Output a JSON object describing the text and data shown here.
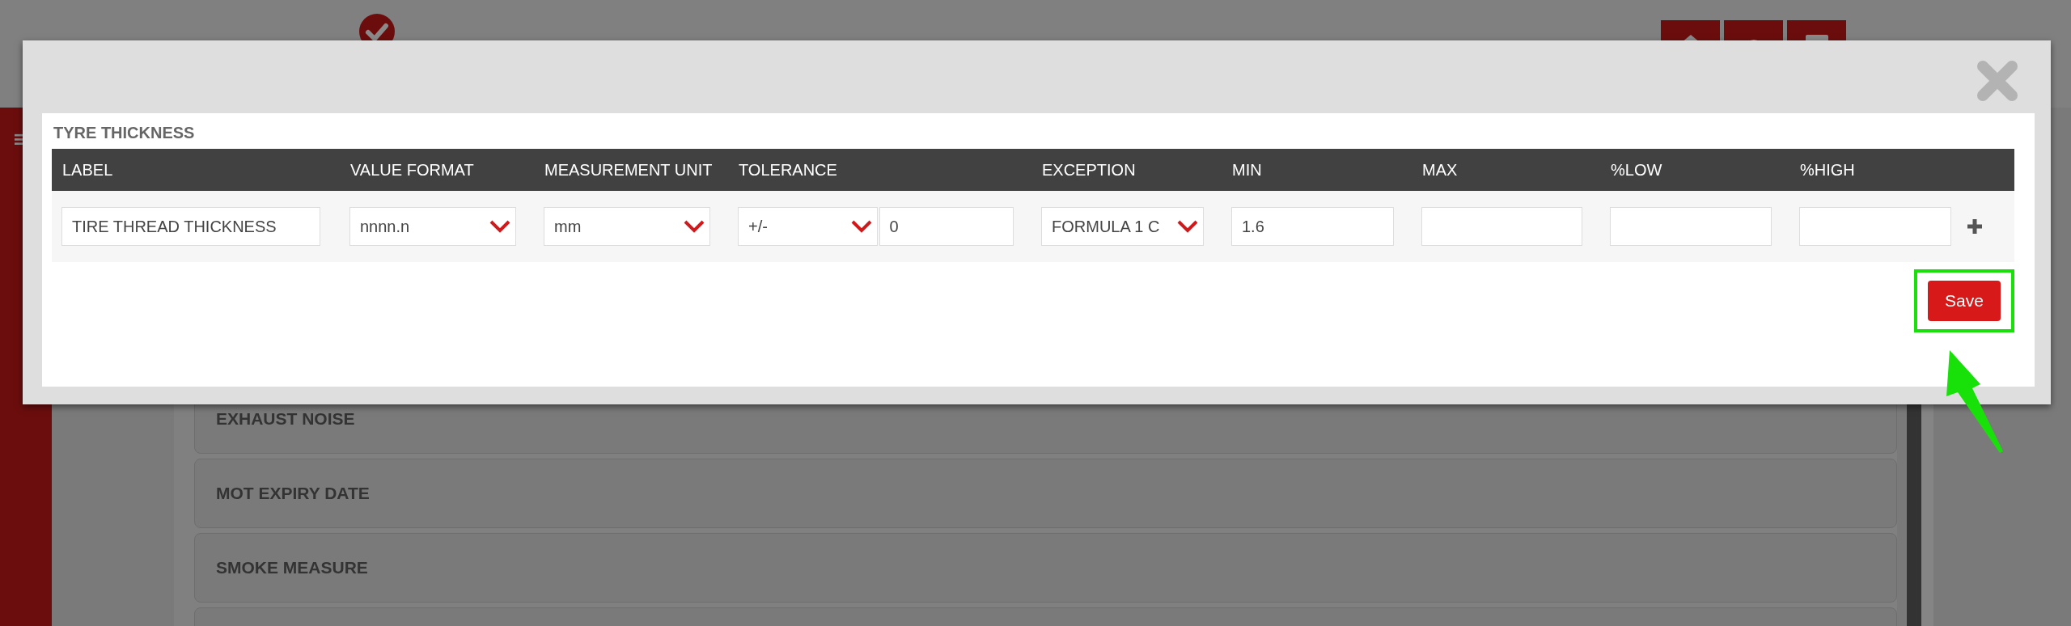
{
  "background": {
    "list_items": [
      {
        "title": "EXHAUST NOISE"
      },
      {
        "title": "MOT EXPIRY DATE"
      },
      {
        "title": "SMOKE MEASURE"
      }
    ]
  },
  "modal": {
    "title": "TYRE THICKNESS",
    "columns": [
      "LABEL",
      "VALUE FORMAT",
      "MEASUREMENT UNIT",
      "TOLERANCE",
      "EXCEPTION",
      "MIN",
      "MAX",
      "%LOW",
      "%HIGH"
    ],
    "cells": [
      {
        "fields": [
          {
            "kind": "text",
            "value": "TIRE THREAD THICKNESS"
          }
        ]
      },
      {
        "fields": [
          {
            "kind": "select",
            "value": "nnnn.n"
          }
        ]
      },
      {
        "fields": [
          {
            "kind": "select",
            "value": "mm"
          }
        ]
      },
      {
        "fields": [
          {
            "kind": "select",
            "value": "+/-"
          },
          {
            "kind": "text",
            "value": "0"
          }
        ]
      },
      {
        "fields": [
          {
            "kind": "select",
            "value": "FORMULA 1 C"
          }
        ]
      },
      {
        "fields": [
          {
            "kind": "text",
            "value": "1.6"
          }
        ]
      },
      {
        "fields": [
          {
            "kind": "text"
          }
        ]
      },
      {
        "fields": [
          {
            "kind": "text"
          }
        ]
      },
      {
        "fields": [
          {
            "kind": "text"
          }
        ]
      }
    ],
    "save_button": "Save",
    "save_highlighted": true
  }
}
